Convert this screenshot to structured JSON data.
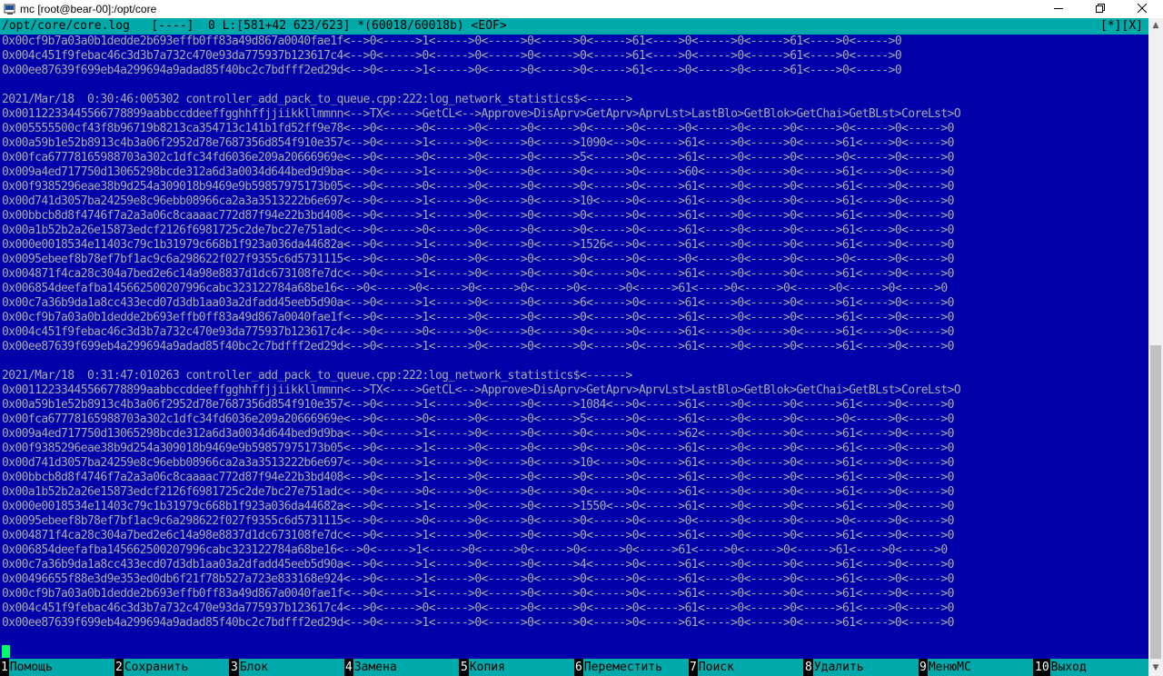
{
  "window": {
    "title": "mc [root@bear-00]:/opt/core",
    "min_icon": "minimize-icon",
    "max_icon": "maximize-icon",
    "close_icon": "close-icon"
  },
  "status_bar": {
    "left": "/opt/core/core.log   [----]  0 L:[581+42 623/623] *(60018/60018b) <EOF>",
    "right": "[*][X]"
  },
  "lines": [
    "0x00cf9b7a03a0b1dedde2b693effb0ff83a49d867a0040fae1f<-->0<----->1<----->0<----->0<----->0<----->61<---->0<----->0<----->61<---->0<----->0",
    "0x004c451f9febac46c3d3b7a732c470e93da775937b123617c4<-->0<----->0<----->0<----->0<----->0<----->61<---->0<----->0<----->61<---->0<----->0",
    "0x00ee87639f699eb4a299694a9adad85f40bc2c7bdfff2ed29d<-->0<----->1<----->0<----->0<----->0<----->61<---->0<----->0<----->61<---->0<----->0",
    "",
    "2021/Mar/18  0:30:46:005302 controller_add_pack_to_queue.cpp:222:log_network_statistics$<------>",
    "0x00112233445566778899aabbccddeeffgghhffjjiikkllmmnn<-->TX<---->GetCL<-->Approve>DisAprv>GetAprv>AprvLst>LastBlo>GetBlok>GetChai>GetBLst>CoreLst>O",
    "0x005555500cf43f8b96719b8213ca354713c141b1fd52ff9e78<-->0<----->0<----->0<----->0<----->0<----->0<----->0<----->0<----->0<----->0<----->0<----->0",
    "0x00a59b1e52b8913c4b3a06f2952d78e7687356d854f910e357<-->0<----->1<----->0<----->0<----->1090<-->0<----->61<---->0<----->0<----->61<---->0<----->0",
    "0x00fca67778165988703a302c1dfc34fd6036e209a20666969e<-->0<----->0<----->0<----->0<----->5<----->0<----->61<---->0<----->0<----->0<----->0<----->0",
    "0x009a4ed717750d13065298bcde312a6d3a0034d644bed9d9ba<-->0<----->1<----->0<----->0<----->0<----->0<----->60<---->0<----->0<----->61<---->0<----->0",
    "0x00f9385296eae38b9d254a309018b9469e9b59857975173b05<-->0<----->0<----->0<----->0<----->0<----->0<----->61<---->0<----->0<----->61<---->0<----->0",
    "0x00d741d3057ba24259e8c96ebb08966ca2a3a3513222b6e697<-->0<----->1<----->0<----->0<----->10<---->0<----->61<---->0<----->0<----->61<---->0<----->0",
    "0x00bbcb8d8f4746f7a2a3a06c8caaaac772d87f94e22b3bd408<-->0<----->1<----->0<----->0<----->0<----->0<----->61<---->0<----->0<----->61<---->0<----->0",
    "0x00a1b52b2a26e15873edcf2126f6981725c2de7bc27e751adc<-->0<----->0<----->0<----->0<----->0<----->0<----->61<---->0<----->0<----->61<---->0<----->0",
    "0x000e0018534e11403c79c1b31979c668b1f923a036da44682a<-->0<----->1<----->0<----->0<----->1526<-->0<----->61<---->0<----->0<----->61<---->0<----->0",
    "0x0095ebeef8b78ef7bf1ac9c6a298622f027f9355c6d5731115<-->0<----->0<----->0<----->0<----->0<----->0<----->0<----->0<----->0<----->0<----->0<----->0",
    "0x004871f4ca28c304a7bed2e6c14a98e8837d1dc673108fe7dc<-->0<----->1<----->0<----->0<----->0<----->0<----->61<---->0<----->0<----->61<---->0<----->0",
    "0x006854deefafba145662500207996cabc323122784a68be16<-->0<----->0<----->0<----->0<----->0<----->0<----->61<---->0<----->0<----->0<----->0<----->0",
    "0x00c7a36b9da1a8cc433ecd07d3db1aa03a2dfadd45eeb5d90a<-->0<----->1<----->0<----->0<----->6<----->0<----->61<---->0<----->0<----->61<---->0<----->0",
    "0x00cf9b7a03a0b1dedde2b693effb0ff83a49d867a0040fae1f<-->0<----->1<----->0<----->0<----->0<----->0<----->61<---->0<----->0<----->61<---->0<----->0",
    "0x004c451f9febac46c3d3b7a732c470e93da775937b123617c4<-->0<----->0<----->0<----->0<----->0<----->0<----->61<---->0<----->0<----->61<---->0<----->0",
    "0x00ee87639f699eb4a299694a9adad85f40bc2c7bdfff2ed29d<-->0<----->1<----->0<----->0<----->0<----->0<----->61<---->0<----->0<----->61<---->0<----->0",
    "",
    "2021/Mar/18  0:31:47:010263 controller_add_pack_to_queue.cpp:222:log_network_statistics$<------>",
    "0x00112233445566778899aabbccddeeffgghhffjjiikkllmmnn<-->TX<---->GetCL<-->Approve>DisAprv>GetAprv>AprvLst>LastBlo>GetBlok>GetChai>GetBLst>CoreLst>O",
    "0x00a59b1e52b8913c4b3a06f2952d78e7687356d854f910e357<-->0<----->1<----->0<----->0<----->1084<-->0<----->61<---->0<----->0<----->61<---->0<----->0",
    "0x00fca67778165988703a302c1dfc34fd6036e209a20666969e<-->0<----->0<----->0<----->0<----->5<----->0<----->61<---->0<----->0<----->0<----->0<----->0",
    "0x009a4ed717750d13065298bcde312a6d3a0034d644bed9d9ba<-->0<----->1<----->0<----->0<----->0<----->0<----->62<---->0<----->0<----->61<---->0<----->0",
    "0x00f9385296eae38b9d254a309018b9469e9b59857975173b05<-->0<----->1<----->0<----->0<----->0<----->0<----->61<---->0<----->0<----->61<---->0<----->0",
    "0x00d741d3057ba24259e8c96ebb08966ca2a3a3513222b6e697<-->0<----->1<----->0<----->0<----->10<---->0<----->61<---->0<----->0<----->61<---->0<----->0",
    "0x00bbcb8d8f4746f7a2a3a06c8caaaac772d87f94e22b3bd408<-->0<----->1<----->0<----->0<----->0<----->0<----->61<---->0<----->0<----->61<---->0<----->0",
    "0x00a1b52b2a26e15873edcf2126f6981725c2de7bc27e751adc<-->0<----->0<----->0<----->0<----->0<----->0<----->61<---->0<----->0<----->61<---->0<----->0",
    "0x000e0018534e11403c79c1b31979c668b1f923a036da44682a<-->0<----->1<----->0<----->0<----->1550<-->0<----->61<---->0<----->0<----->61<---->0<----->0",
    "0x0095ebeef8b78ef7bf1ac9c6a298622f027f9355c6d5731115<-->0<----->0<----->0<----->0<----->0<----->0<----->0<----->0<----->0<----->0<----->0<----->0",
    "0x004871f4ca28c304a7bed2e6c14a98e8837d1dc673108fe7dc<-->0<----->1<----->0<----->0<----->0<----->0<----->61<---->0<----->0<----->61<---->0<----->0",
    "0x006854deefafba145662500207996cabc323122784a68be16<-->0<----->1<----->0<----->0<----->0<----->0<----->61<---->0<----->0<----->61<---->0<----->0",
    "0x00c7a36b9da1a8cc433ecd07d3db1aa03a2dfadd45eeb5d90a<-->0<----->1<----->0<----->0<----->4<----->0<----->61<---->0<----->0<----->61<---->0<----->0",
    "0x00496655f88e3d9e353ed0db6f21f78b527a723e833168e924<-->0<----->1<----->0<----->0<----->0<----->0<----->61<---->0<----->0<----->61<---->0<----->0",
    "0x00cf9b7a03a0b1dedde2b693effb0ff83a49d867a0040fae1f<-->0<----->1<----->0<----->0<----->0<----->0<----->61<---->0<----->0<----->61<---->0<----->0",
    "0x004c451f9febac46c3d3b7a732c470e93da775937b123617c4<-->0<----->0<----->0<----->0<----->0<----->0<----->61<---->0<----->0<----->61<---->0<----->0",
    "0x00ee87639f699eb4a299694a9adad85f40bc2c7bdfff2ed29d<-->0<----->1<----->0<----->0<----->0<----->0<----->61<---->0<----->0<----->61<---->0<----->0"
  ],
  "function_keys": [
    {
      "num": "1",
      "label": "Помощь"
    },
    {
      "num": "2",
      "label": "Сохранить"
    },
    {
      "num": "3",
      "label": "Блок"
    },
    {
      "num": "4",
      "label": "Замена"
    },
    {
      "num": "5",
      "label": "Копия"
    },
    {
      "num": "6",
      "label": "Переместить"
    },
    {
      "num": "7",
      "label": "Поиск"
    },
    {
      "num": "8",
      "label": "Удалить"
    },
    {
      "num": "9",
      "label": "МенюMC"
    },
    {
      "num": "10",
      "label": "Выход"
    }
  ],
  "colors": {
    "background": "#0000aa",
    "text": "#aaaaaa",
    "bar": "#00aaaa",
    "cursor": "#00ff66"
  }
}
